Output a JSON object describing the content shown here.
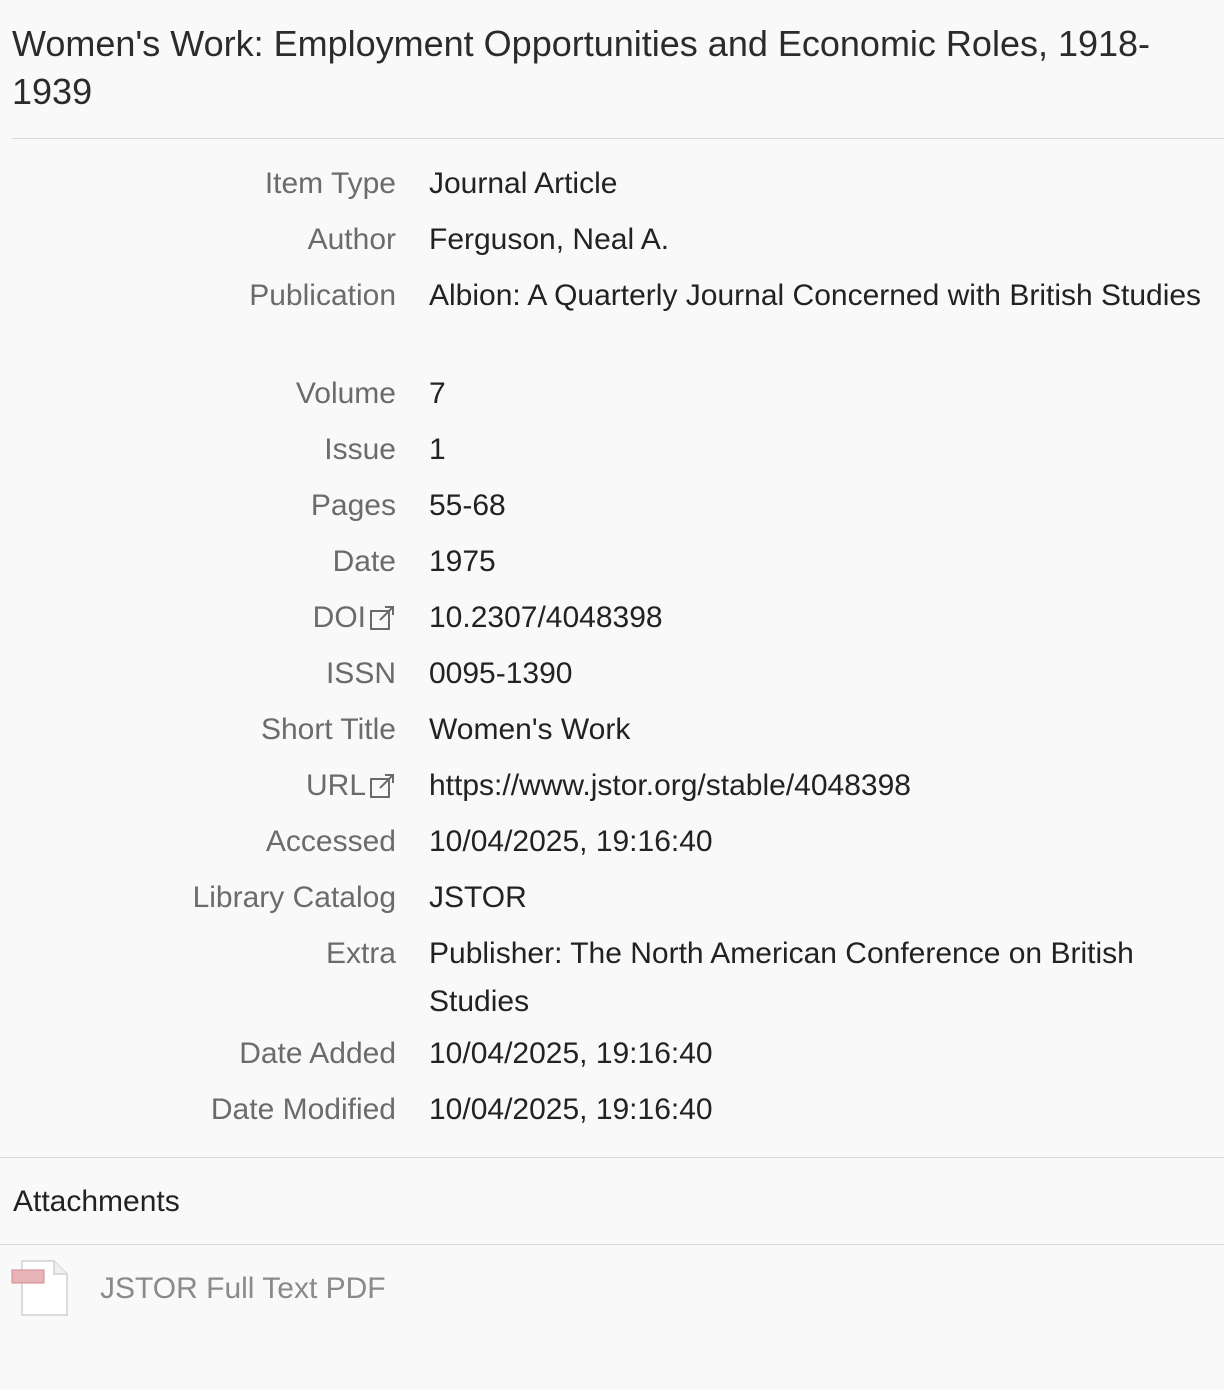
{
  "item": {
    "title": "Women's Work: Employment Opportunities and Economic Roles, 1918-1939"
  },
  "fields": [
    {
      "label": "Item Type",
      "value": "Journal Article"
    },
    {
      "label": "Author",
      "value": "Ferguson, Neal A."
    },
    {
      "label": "Publication",
      "value": "Albion: A Quarterly Journal Concerned with British Studies"
    },
    {
      "label": "Volume",
      "value": "7"
    },
    {
      "label": "Issue",
      "value": "1"
    },
    {
      "label": "Pages",
      "value": "55-68"
    },
    {
      "label": "Date",
      "value": "1975"
    },
    {
      "label": "DOI",
      "value": "10.2307/4048398",
      "icon": "external-link-icon"
    },
    {
      "label": "ISSN",
      "value": "0095-1390"
    },
    {
      "label": "Short Title",
      "value": "Women's Work"
    },
    {
      "label": "URL",
      "value": "https://www.jstor.org/stable/4048398",
      "icon": "external-link-icon"
    },
    {
      "label": "Accessed",
      "value": "10/04/2025, 19:16:40"
    },
    {
      "label": "Library Catalog",
      "value": "JSTOR"
    },
    {
      "label": "Extra",
      "value": "Publisher: The North American Conference on British Studies"
    },
    {
      "label": "Date Added",
      "value": "10/04/2025, 19:16:40"
    },
    {
      "label": "Date Modified",
      "value": "10/04/2025, 19:16:40"
    }
  ],
  "attachments": {
    "heading": "Attachments",
    "items": [
      {
        "label": "JSTOR Full Text PDF",
        "icon": "pdf-file-icon"
      }
    ]
  },
  "colors": {
    "background": "#f9f9f9",
    "label": "#6b6b6b",
    "value": "#222222",
    "attachment_text": "#8a8a8a",
    "pdf_accent": "#e8b4b8"
  }
}
